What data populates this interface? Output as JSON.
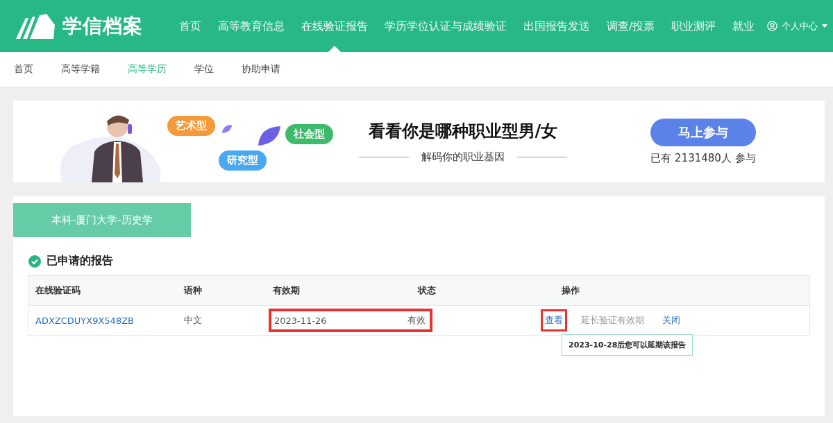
{
  "header": {
    "logo": "学信档案",
    "nav": [
      {
        "label": "首页",
        "selected": false
      },
      {
        "label": "高等教育信息",
        "selected": false
      },
      {
        "label": "在线验证报告",
        "selected": true
      },
      {
        "label": "学历学位认证与成绩验证",
        "selected": false
      },
      {
        "label": "出国报告发送",
        "selected": false
      },
      {
        "label": "调查/投票",
        "selected": false
      },
      {
        "label": "职业测评",
        "selected": false
      },
      {
        "label": "就业",
        "selected": false
      }
    ],
    "user_menu": "个人中心"
  },
  "subnav": [
    {
      "label": "首页",
      "selected": false
    },
    {
      "label": "高等学籍",
      "selected": false
    },
    {
      "label": "高等学历",
      "selected": true
    },
    {
      "label": "学位",
      "selected": false
    },
    {
      "label": "协助申请",
      "selected": false
    }
  ],
  "banner": {
    "tags": [
      {
        "label": "艺术型",
        "color": "#f59a3a"
      },
      {
        "label": "社会型",
        "color": "#3dbb6a"
      },
      {
        "label": "研究型",
        "color": "#4aa8f0"
      }
    ],
    "headline": "看看你是哪种职业型男/女",
    "subtitle": "解码你的职业基因",
    "button": "马上参与",
    "participants_prefix": "已有",
    "participants_count": "2131480人",
    "participants_suffix": "参与"
  },
  "record_tab": "本科-厦门大学-历史学",
  "section_title": "已申请的报告",
  "table": {
    "columns": [
      "在线验证码",
      "语种",
      "有效期",
      "状态",
      "操作"
    ],
    "rows": [
      {
        "code": "ADXZCDUYX9X548ZB",
        "language": "中文",
        "expiry": "2023-11-26",
        "status": "有效",
        "validity_highlighted": true,
        "actions": [
          {
            "label": "查看",
            "disabled": false,
            "highlighted": true
          },
          {
            "label": "延长验证有效期",
            "disabled": true,
            "highlighted": false
          },
          {
            "label": "关闭",
            "disabled": false,
            "highlighted": false
          }
        ],
        "tooltip": "2023-10-28后您可以延期该报告"
      }
    ]
  }
}
